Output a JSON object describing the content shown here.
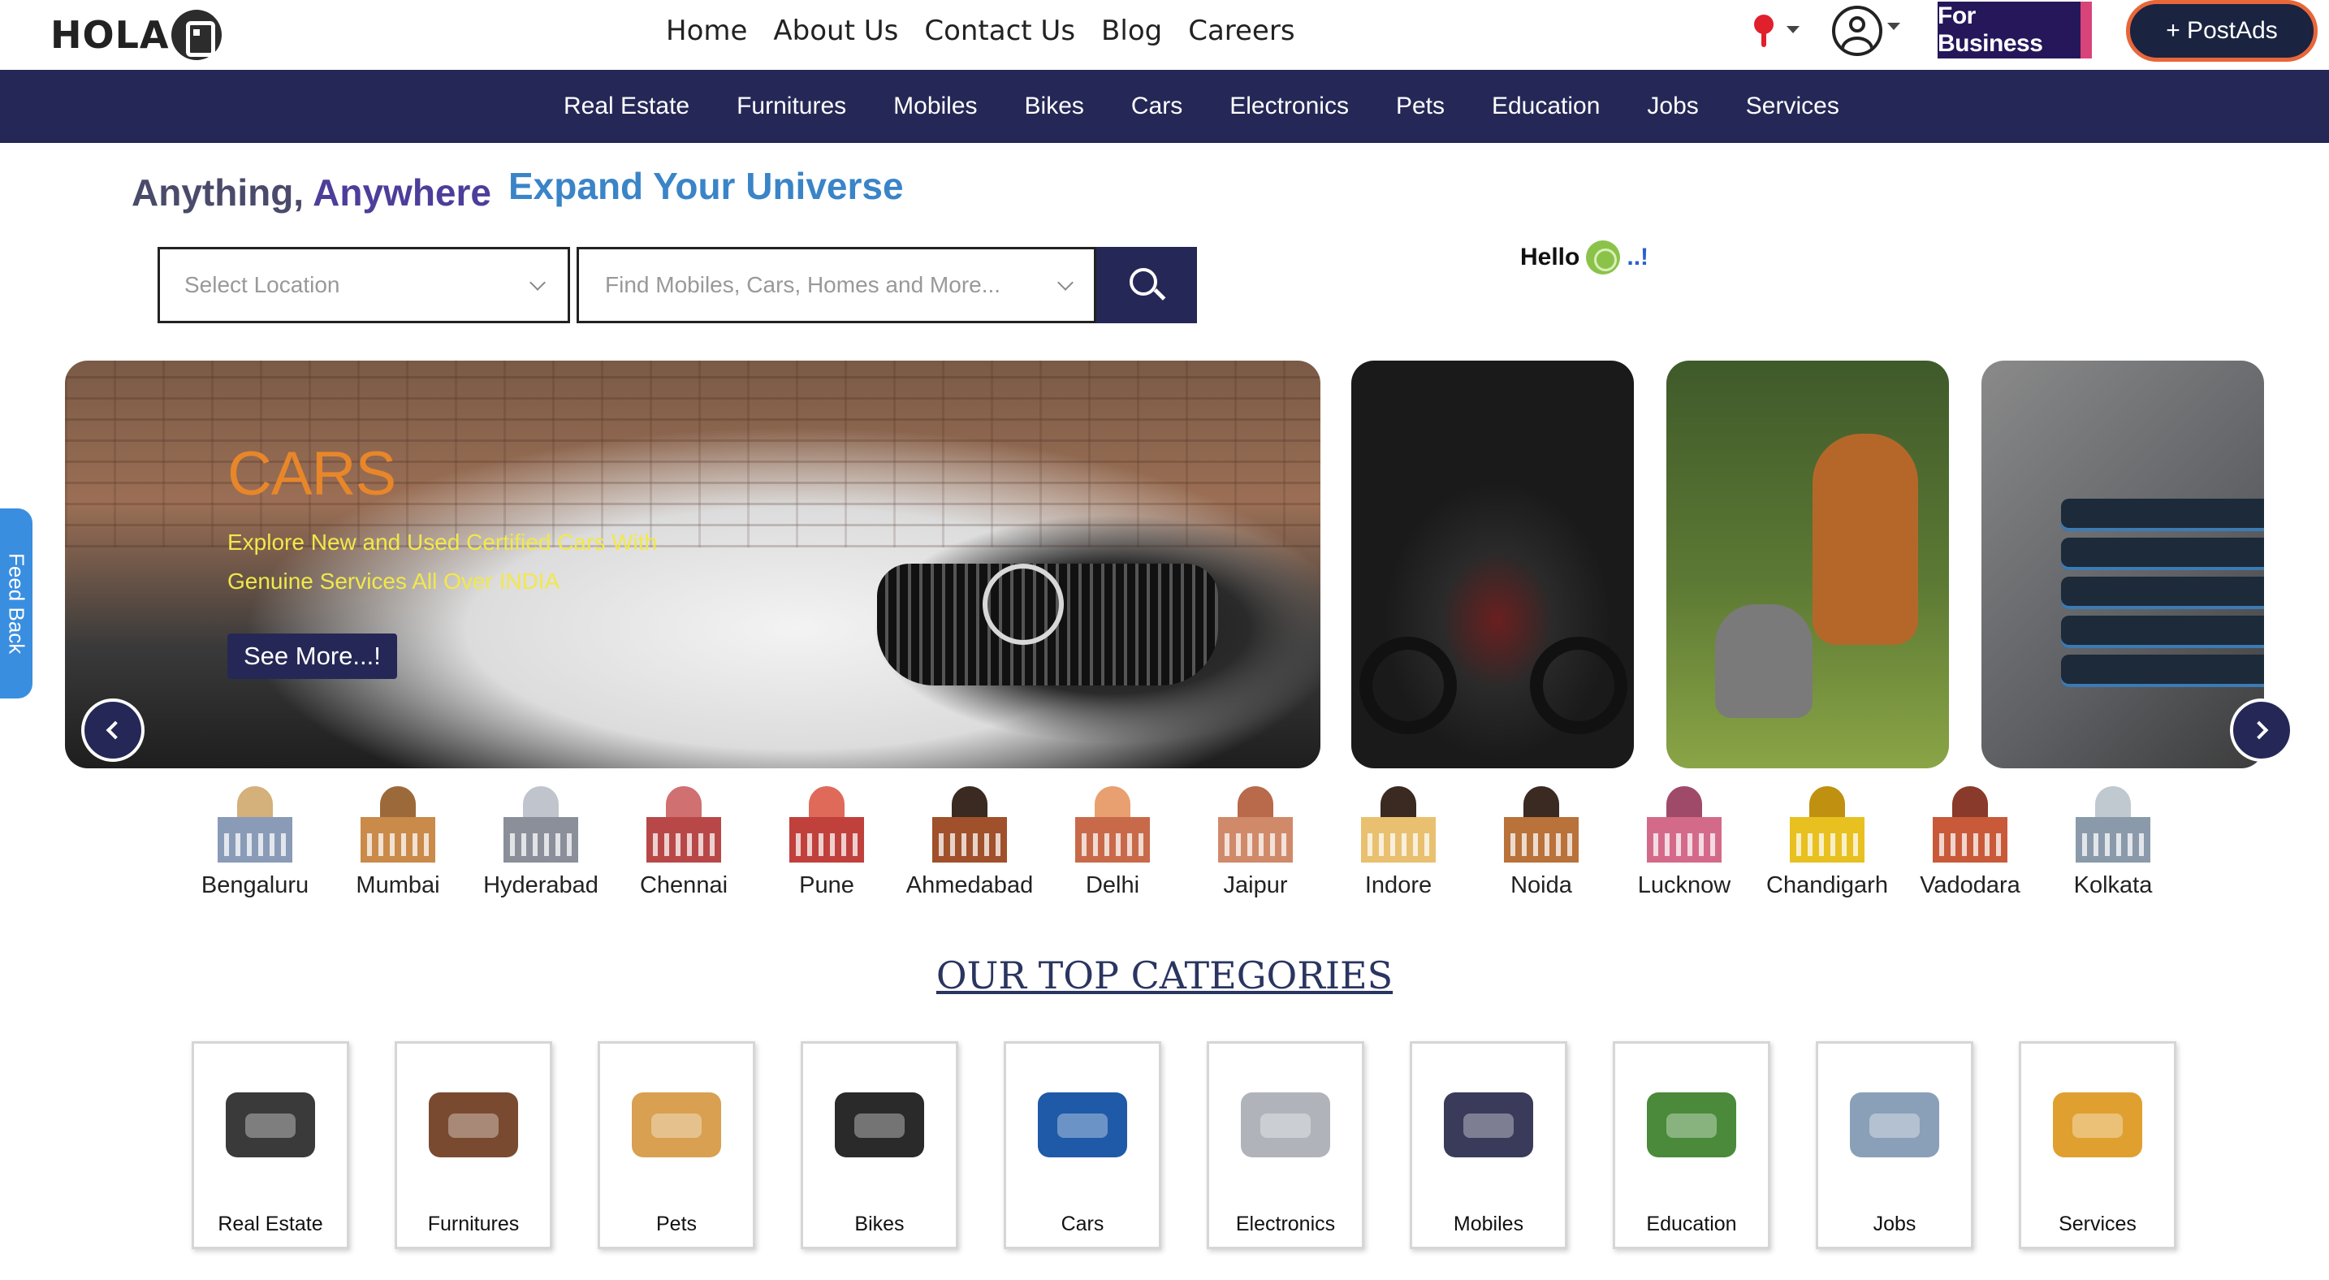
{
  "brand": {
    "logo_text": "HOLA"
  },
  "header": {
    "nav": [
      "Home",
      "About Us",
      "Contact Us",
      "Blog",
      "Careers"
    ],
    "for_business": "For Business",
    "post_ads": "+ PostAds"
  },
  "category_bar": [
    "Real Estate",
    "Furnitures",
    "Mobiles",
    "Bikes",
    "Cars",
    "Electronics",
    "Pets",
    "Education",
    "Jobs",
    "Services"
  ],
  "tagline": {
    "part1": "Anything,",
    "part2": "Anywhere",
    "right": "Expand Your Universe"
  },
  "search": {
    "location_placeholder": "Select Location",
    "query_placeholder": "Find Mobiles, Cars, Homes and More...",
    "button_icon": "search-icon"
  },
  "greeting": {
    "text": "Hello",
    "suffix": "..!"
  },
  "hero": {
    "title": "CARS",
    "subtitle": "Explore New and Used Certified Cars With Genuine Services All Over INDIA",
    "button": "See More...!",
    "side_cards": [
      "bike",
      "pets",
      "mobiles"
    ]
  },
  "feedback_tab": "Feed Back",
  "cities": [
    {
      "name": "Bengaluru",
      "color": "#8a9bb8",
      "accent": "#d4b07a"
    },
    {
      "name": "Mumbai",
      "color": "#c98a4a",
      "accent": "#9c6a3a"
    },
    {
      "name": "Hyderabad",
      "color": "#8a8f9a",
      "accent": "#c0c4cc"
    },
    {
      "name": "Chennai",
      "color": "#b84848",
      "accent": "#d07070"
    },
    {
      "name": "Pune",
      "color": "#c0403c",
      "accent": "#e06a5a"
    },
    {
      "name": "Ahmedabad",
      "color": "#a0502a",
      "accent": "#3a2a22"
    },
    {
      "name": "Delhi",
      "color": "#c86a4a",
      "accent": "#e8a070"
    },
    {
      "name": "Jaipur",
      "color": "#d08a6a",
      "accent": "#b86a4a"
    },
    {
      "name": "Indore",
      "color": "#e8c070",
      "accent": "#3a2a22"
    },
    {
      "name": "Noida",
      "color": "#b8723a",
      "accent": "#3a2a22"
    },
    {
      "name": "Lucknow",
      "color": "#d46a8a",
      "accent": "#a04a6a"
    },
    {
      "name": "Chandigarh",
      "color": "#e8c020",
      "accent": "#c09010"
    },
    {
      "name": "Vadodara",
      "color": "#c85a3a",
      "accent": "#8a3a2a"
    },
    {
      "name": "Kolkata",
      "color": "#8a9aaa",
      "accent": "#c0c8d0"
    }
  ],
  "top_categories": {
    "title": "OUR TOP CATEGORIES",
    "items": [
      {
        "label": "Real Estate",
        "icon": "house-icon",
        "color": "#3a3a3a"
      },
      {
        "label": "Furnitures",
        "icon": "armchair-icon",
        "color": "#7a4a30"
      },
      {
        "label": "Pets",
        "icon": "dog-icon",
        "color": "#d8a050"
      },
      {
        "label": "Bikes",
        "icon": "motorbike-icon",
        "color": "#2a2a2a"
      },
      {
        "label": "Cars",
        "icon": "car-icon",
        "color": "#1e5aa8"
      },
      {
        "label": "Electronics",
        "icon": "appliances-icon",
        "color": "#b0b4ba"
      },
      {
        "label": "Mobiles",
        "icon": "smartphones-icon",
        "color": "#3a3a5a"
      },
      {
        "label": "Education",
        "icon": "books-icon",
        "color": "#4a8a3a"
      },
      {
        "label": "Jobs",
        "icon": "jobs-magnifier-icon",
        "color": "#8aa0b8"
      },
      {
        "label": "Services",
        "icon": "service-worker-icon",
        "color": "#e0a030"
      }
    ]
  }
}
